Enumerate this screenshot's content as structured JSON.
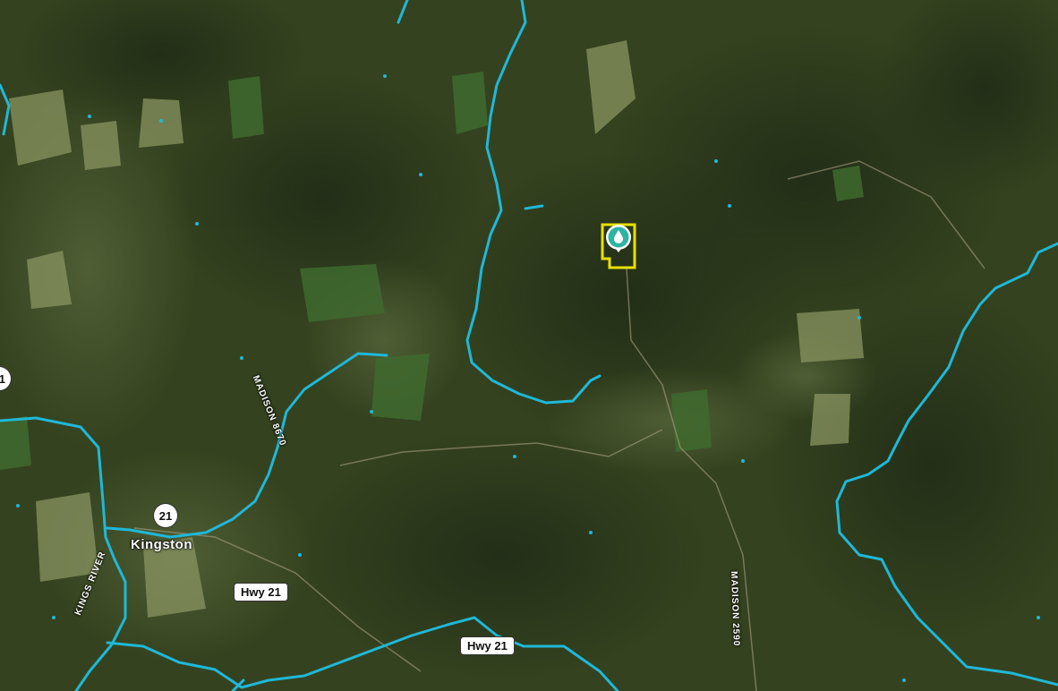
{
  "labels": {
    "town": "Kingston",
    "river": "KINGS RIVER",
    "road_madison_a": "MADISON 8670",
    "road_madison_b": "MADISON 2590"
  },
  "shields": {
    "route_circle": "21",
    "route_circle_left": "1",
    "hwy_a": "Hwy 21",
    "hwy_b": "Hwy 21"
  },
  "marker": {
    "icon": "water-drop-icon",
    "marker_color": "#2fb3a3",
    "parcel_color": "#e8e000"
  },
  "colors": {
    "river": "#1fb8d8",
    "terrain_dark": "#25321b",
    "terrain_mid": "#3b4a2b",
    "field": "#7c8a52"
  }
}
